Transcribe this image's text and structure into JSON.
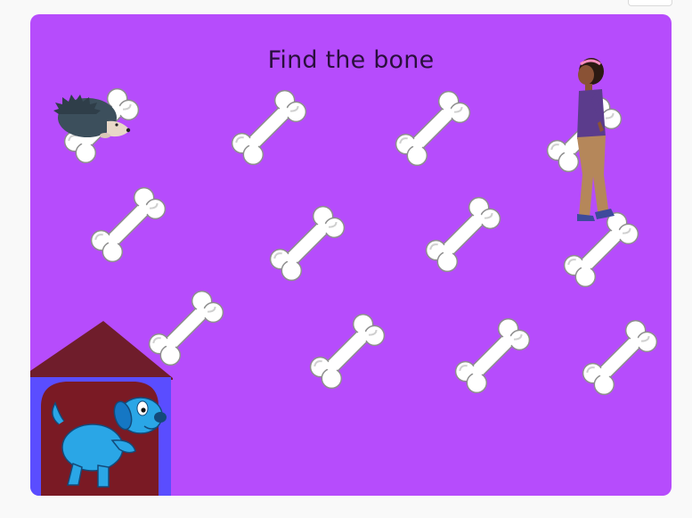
{
  "game": {
    "title": "Find the bone"
  },
  "colors": {
    "stage_bg": "#b64cfc",
    "page_bg": "#f9f9f9",
    "bone_fill": "#ffffff",
    "bone_stroke": "#8e8e8e",
    "house_roof": "#6f1d2b",
    "house_wall": "#5a4dff",
    "house_door": "#7a1a24",
    "dog": "#2aa6e6",
    "hedgehog": "#3c4f5c",
    "girl_shirt": "#5b3c8c",
    "girl_pants": "#b5875a"
  },
  "sprites": {
    "hedgehog": "hedgehog-sprite",
    "girl": "girl-sprite",
    "dog": "blue-dog-sprite",
    "doghouse": "doghouse-sprite",
    "bone": "bone-sprite"
  }
}
